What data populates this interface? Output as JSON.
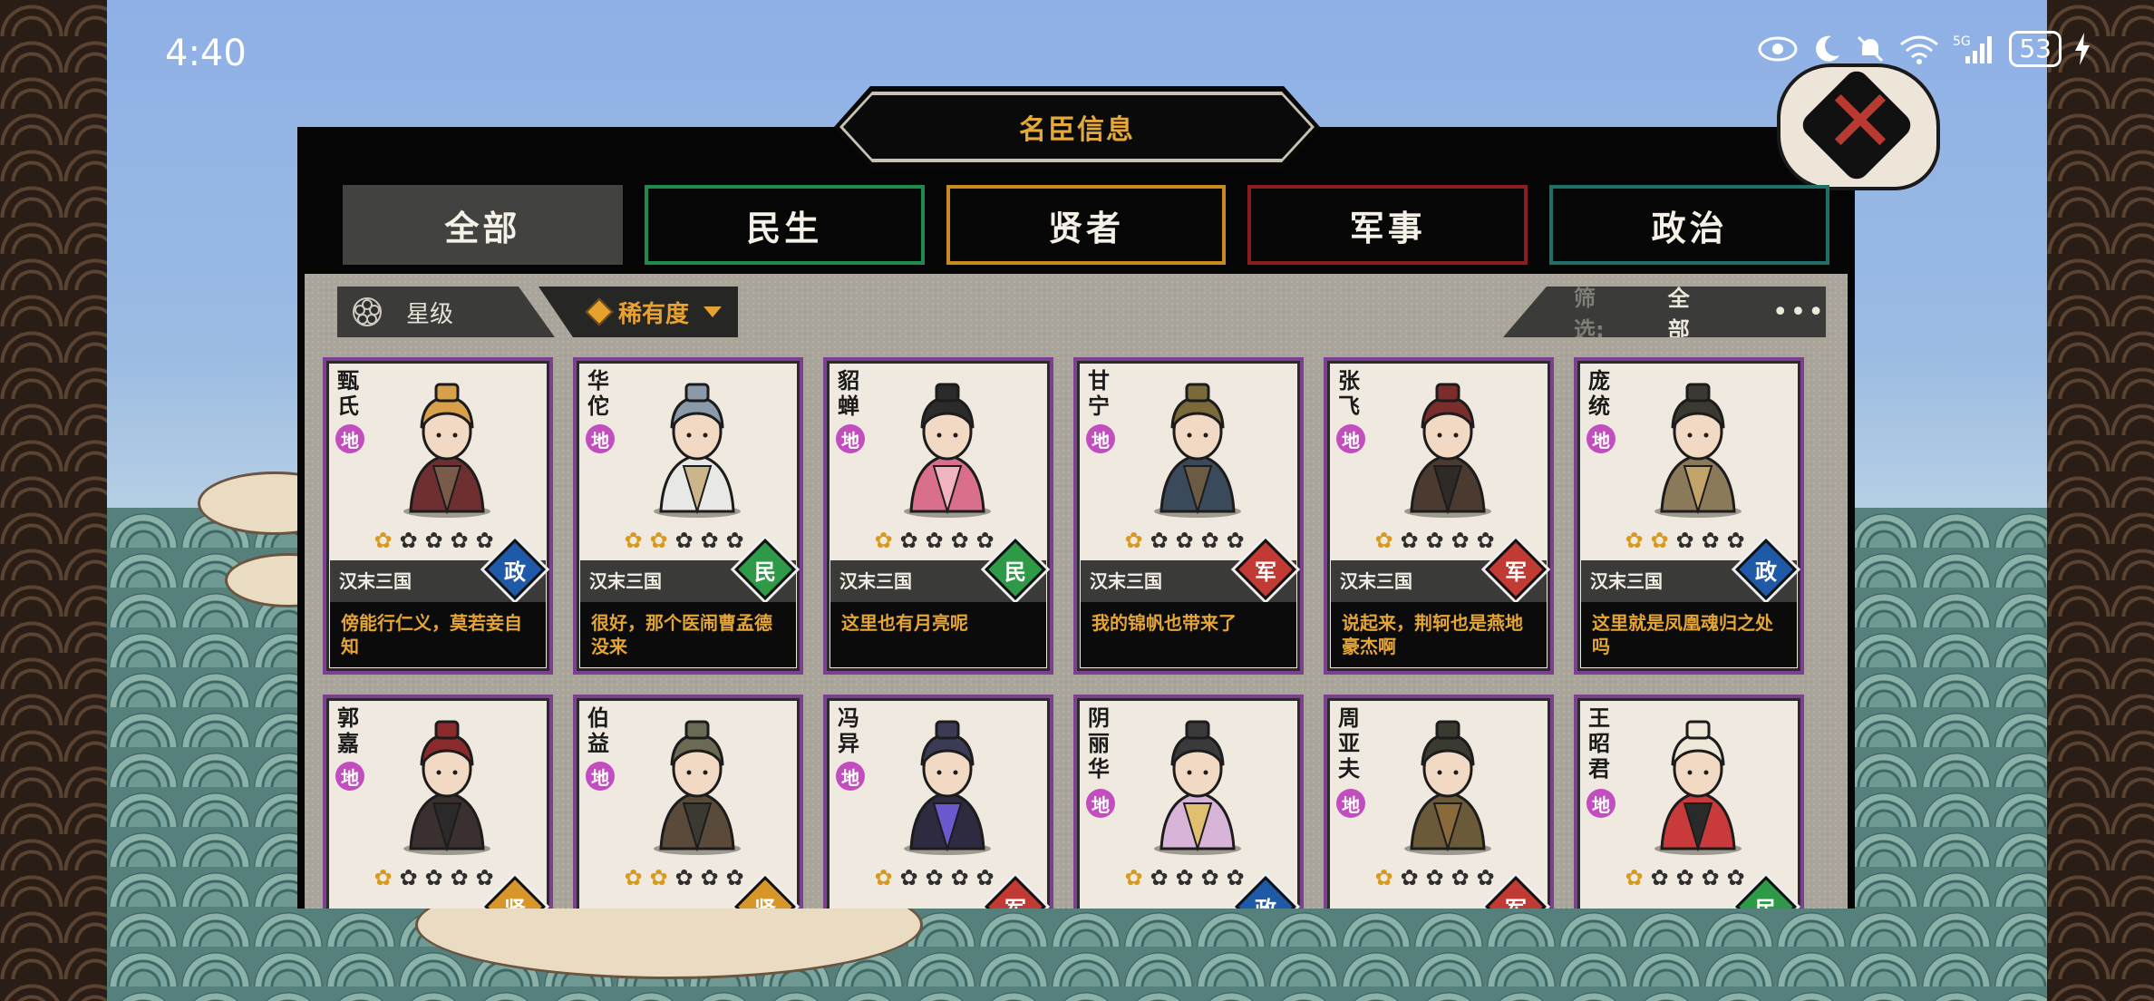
{
  "status_bar": {
    "time": "4:40",
    "battery": "53",
    "network": "5G"
  },
  "panel": {
    "title": "名臣信息",
    "close_icon": "close-x-icon"
  },
  "tabs": [
    {
      "label": "全部",
      "color": "#424240",
      "active": true
    },
    {
      "label": "民生",
      "color": "#1e8a4c",
      "active": false
    },
    {
      "label": "贤者",
      "color": "#c88a1e",
      "active": false
    },
    {
      "label": "军事",
      "color": "#8a1e1e",
      "active": false
    },
    {
      "label": "政治",
      "color": "#1e6e6a",
      "active": false
    }
  ],
  "sortbar": {
    "star_label": "星级",
    "rarity_label": "稀有度"
  },
  "filter": {
    "label": "筛选:",
    "value": "全部",
    "more": "•••"
  },
  "category_colors": {
    "政": "#1f5aa8",
    "民": "#2e9a48",
    "军": "#c23a34",
    "贤": "#d7962a"
  },
  "cards": [
    {
      "name": "甄氏",
      "rank": "地",
      "stars": 1,
      "era": "汉末三国",
      "category": "政",
      "quote": "傍能行仁义，莫若妾自知"
    },
    {
      "name": "华佗",
      "rank": "地",
      "stars": 2,
      "era": "汉末三国",
      "category": "民",
      "quote": "很好，那个医闹曹孟德没来"
    },
    {
      "name": "貂蝉",
      "rank": "地",
      "stars": 1,
      "era": "汉末三国",
      "category": "民",
      "quote": "这里也有月亮呢"
    },
    {
      "name": "甘宁",
      "rank": "地",
      "stars": 1,
      "era": "汉末三国",
      "category": "军",
      "quote": "我的锦帆也带来了"
    },
    {
      "name": "张飞",
      "rank": "地",
      "stars": 1,
      "era": "汉末三国",
      "category": "军",
      "quote": "说起来，荆轲也是燕地豪杰啊"
    },
    {
      "name": "庞统",
      "rank": "地",
      "stars": 2,
      "era": "汉末三国",
      "category": "政",
      "quote": "这里就是凤凰魂归之处吗"
    },
    {
      "name": "郭嘉",
      "rank": "地",
      "stars": 1,
      "era": "",
      "category": "贤",
      "quote": ""
    },
    {
      "name": "伯益",
      "rank": "地",
      "stars": 2,
      "era": "",
      "category": "贤",
      "quote": ""
    },
    {
      "name": "冯异",
      "rank": "地",
      "stars": 1,
      "era": "",
      "category": "军",
      "quote": ""
    },
    {
      "name": "阴丽华",
      "rank": "地",
      "stars": 1,
      "era": "",
      "category": "政",
      "quote": ""
    },
    {
      "name": "周亚夫",
      "rank": "地",
      "stars": 1,
      "era": "",
      "category": "军",
      "quote": ""
    },
    {
      "name": "王昭君",
      "rank": "地",
      "stars": 1,
      "era": "",
      "category": "民",
      "quote": ""
    }
  ]
}
